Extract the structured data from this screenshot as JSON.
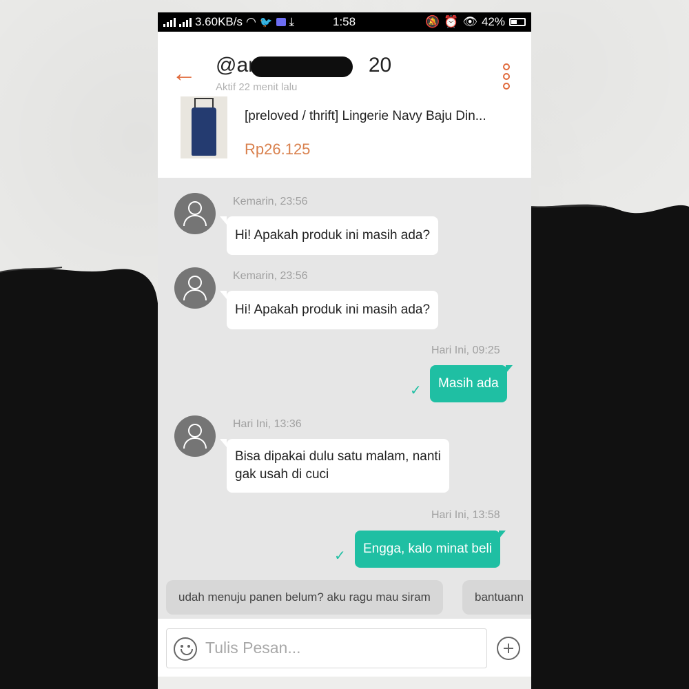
{
  "status_bar": {
    "network_speed": "3.60KB/s",
    "time": "1:58",
    "battery": "42%"
  },
  "header": {
    "username_prefix": "@an",
    "username_suffix": "20",
    "status": "Aktif 22 menit lalu",
    "back_icon": "arrow-left-icon",
    "menu_icon": "kebab-menu-icon"
  },
  "product": {
    "title": "[preloved / thrift] Lingerie Navy Baju Din...",
    "price": "Rp26.125"
  },
  "messages": [
    {
      "direction": "in",
      "timestamp": "Kemarin, 23:56",
      "text": "Hi! Apakah produk ini masih ada?"
    },
    {
      "direction": "in",
      "timestamp": "Kemarin, 23:56",
      "text": "Hi! Apakah produk ini masih ada?"
    },
    {
      "direction": "out",
      "timestamp": "Hari Ini, 09:25",
      "text": "Masih ada"
    },
    {
      "direction": "in",
      "timestamp": "Hari Ini, 13:36",
      "text_line1": "Bisa dipakai dulu satu malam, nanti",
      "text_line2": "gak usah di cuci"
    },
    {
      "direction": "out",
      "timestamp": "Hari Ini, 13:58",
      "text": "Engga, kalo minat beli"
    }
  ],
  "suggestions": [
    "udah menuju panen belum? aku ragu mau siram",
    "bantuann"
  ],
  "composer": {
    "placeholder": "Tulis Pesan..."
  },
  "colors": {
    "accent": "#e0693a",
    "outgoing_bubble": "#1fbfa3",
    "price": "#d9814e"
  }
}
